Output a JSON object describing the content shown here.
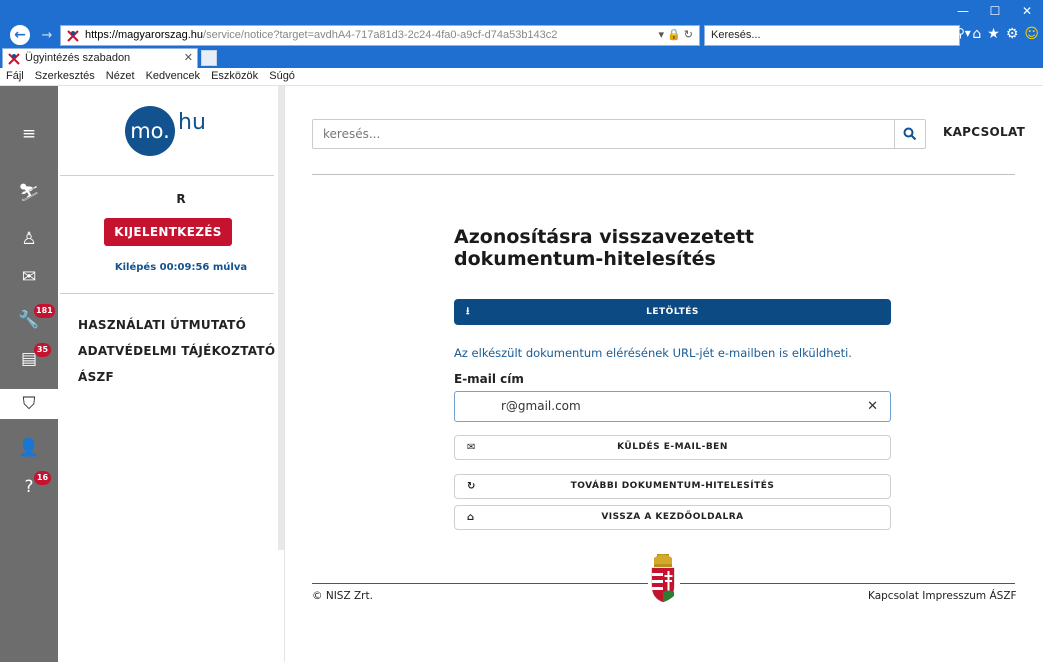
{
  "browser": {
    "url_domain": "https://magyarorszag.hu",
    "url_path": "/service/notice?target=avdhA4-717a81d3-2c24-4fa0-a9cf-d74a53b143c2",
    "search_placeholder": "Keresés...",
    "tab_title": "Ügyintézés szabadon",
    "menu": [
      "Fájl",
      "Szerkesztés",
      "Nézet",
      "Kedvencek",
      "Eszközök",
      "Súgó"
    ]
  },
  "rail": {
    "badges": {
      "tools": "181",
      "news": "35",
      "help": "16"
    }
  },
  "sidebar": {
    "logo_mo": "mo.",
    "logo_hu": "hu",
    "username": "R",
    "logout_label": "KIJELENTKEZÉS",
    "logout_timer": "Kilépés 00:09:56 múlva",
    "links": [
      "HASZNÁLATI ÚTMUTATÓ",
      "ADATVÉDELMI TÁJÉKOZTATÓ",
      "ÁSZF"
    ]
  },
  "header": {
    "search_placeholder": "keresés...",
    "contact_label": "KAPCSOLAT"
  },
  "main": {
    "title": "Azonosításra visszavezetett dokumentum-hitelesítés",
    "download_label": "LETÖLTÉS",
    "info_text": "Az elkészült dokumentum elérésének URL-jét e-mailben is elküldheti.",
    "email_label": "E-mail cím",
    "email_value": "r@gmail.com",
    "send_label": "KÜLDÉS E-MAIL-BEN",
    "more_label": "TOVÁBBI DOKUMENTUM-HITELESÍTÉS",
    "home_label": "VISSZA A KEZDŐOLDALRA"
  },
  "footer": {
    "copyright": "© NISZ Zrt.",
    "links": [
      "Kapcsolat",
      "Impresszum",
      "ÁSZF"
    ]
  },
  "colors": {
    "accent_blue": "#0c4a83",
    "logout_red": "#c4122f",
    "rail_gray": "#6d6d6d"
  }
}
